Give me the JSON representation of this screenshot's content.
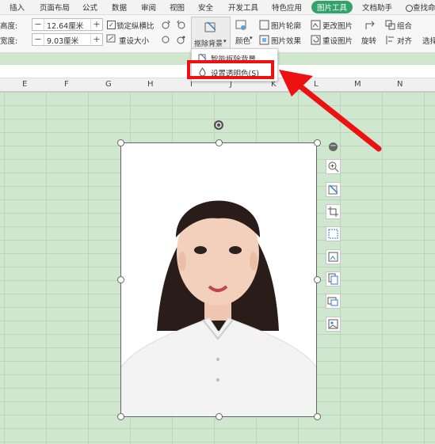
{
  "tabs": [
    "插入",
    "页面布局",
    "公式",
    "数据",
    "审阅",
    "视图",
    "安全",
    "开发工具",
    "特色应用",
    "图片工具",
    "文档助手",
    "查找命"
  ],
  "ribbon": {
    "height_label": "高度:",
    "height_value": "12.64厘米",
    "width_label": "宽度:",
    "width_value": "9.03厘米",
    "lock_ratio": "锁定纵横比",
    "reset_size": "重设大小",
    "remove_bg": "抠除背景",
    "color": "颜色",
    "outline": "图片轮廓",
    "effects": "图片效果",
    "change_pic": "更改图片",
    "reset_pic": "重设图片",
    "rotate": "旋转",
    "group": "组合",
    "align": "对齐",
    "select": "选择"
  },
  "dropdown": {
    "items": [
      "智能抠除背景",
      "设置透明色(S)"
    ]
  },
  "columns": [
    "E",
    "F",
    "G",
    "H",
    "I",
    "J",
    "K",
    "L",
    "M",
    "N"
  ],
  "colors": {
    "accent": "#33a36b",
    "highlight": "#ee1111",
    "sheet_bg": "#cfe6cf"
  }
}
